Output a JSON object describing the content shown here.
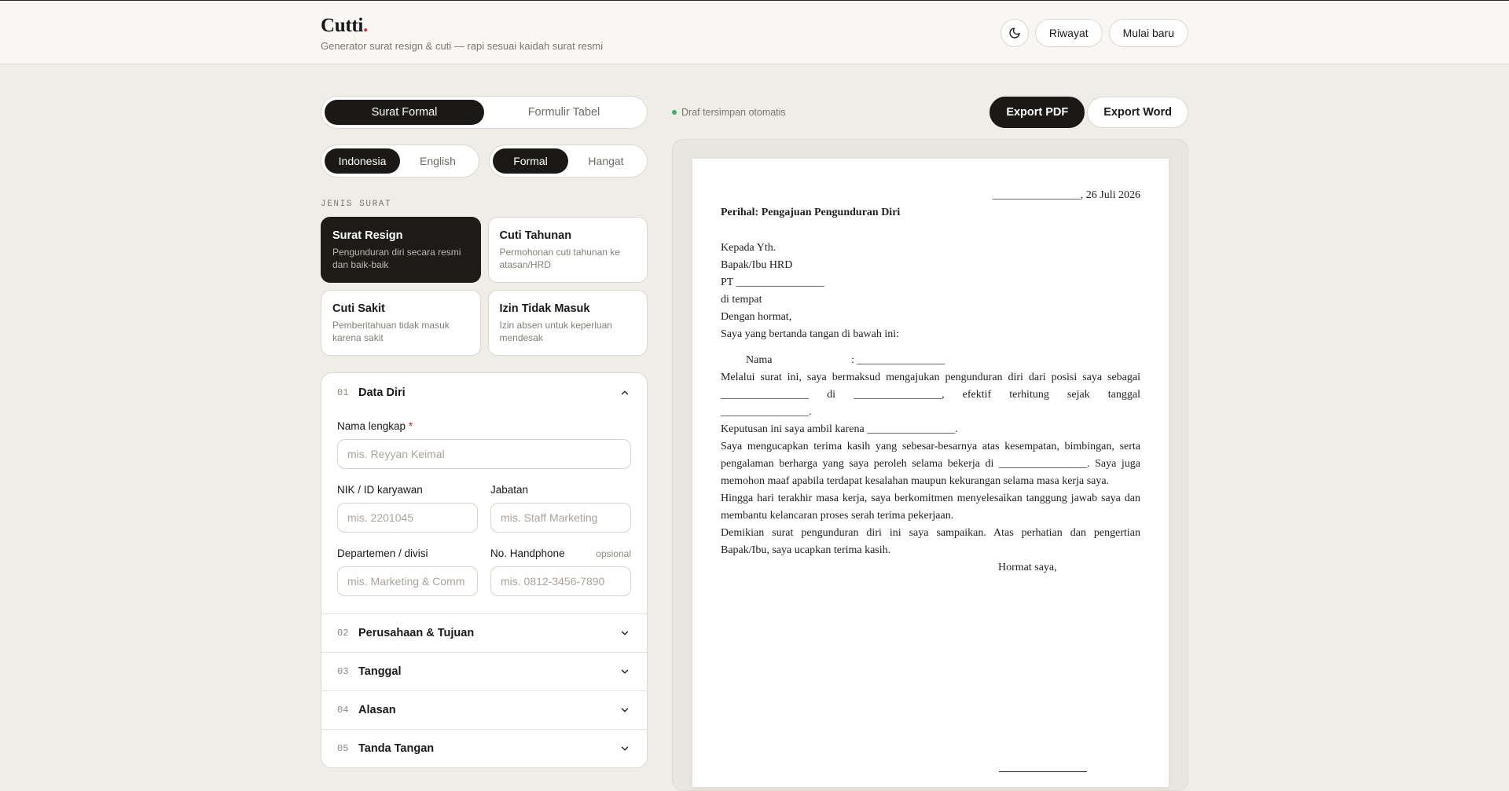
{
  "header": {
    "brand": "Cutti",
    "brand_dot": ".",
    "tagline": "Generator surat resign & cuti — rapi sesuai kaidah surat resmi",
    "theme_icon": "moon-icon",
    "history_label": "Riwayat",
    "new_label": "Mulai baru"
  },
  "mode_tabs": [
    {
      "label": "Surat Formal",
      "active": true
    },
    {
      "label": "Formulir Tabel",
      "active": false
    }
  ],
  "language_tabs": [
    {
      "label": "Indonesia",
      "active": true
    },
    {
      "label": "English",
      "active": false
    }
  ],
  "tone_tabs": [
    {
      "label": "Formal",
      "active": true
    },
    {
      "label": "Hangat",
      "active": false
    }
  ],
  "letter_types": {
    "section_label": "JENIS SURAT",
    "items": [
      {
        "title": "Surat Resign",
        "desc": "Pengunduran diri secara resmi dan baik-baik",
        "active": true
      },
      {
        "title": "Cuti Tahunan",
        "desc": "Permohonan cuti tahunan ke atasan/HRD",
        "active": false
      },
      {
        "title": "Cuti Sakit",
        "desc": "Pemberitahuan tidak masuk karena sakit",
        "active": false
      },
      {
        "title": "Izin Tidak Masuk",
        "desc": "Izin absen untuk keperluan mendesak",
        "active": false
      }
    ]
  },
  "form": {
    "sections": [
      {
        "num": "01",
        "title": "Data Diri",
        "open": true
      },
      {
        "num": "02",
        "title": "Perusahaan & Tujuan",
        "open": false
      },
      {
        "num": "03",
        "title": "Tanggal",
        "open": false
      },
      {
        "num": "04",
        "title": "Alasan",
        "open": false
      },
      {
        "num": "05",
        "title": "Tanda Tangan",
        "open": false
      }
    ],
    "fields": {
      "name": {
        "label": "Nama lengkap",
        "required_mark": "*",
        "placeholder": "mis. Reyyan Keimal"
      },
      "nik": {
        "label": "NIK / ID karyawan",
        "placeholder": "mis. 2201045"
      },
      "position": {
        "label": "Jabatan",
        "placeholder": "mis. Staff Marketing"
      },
      "department": {
        "label": "Departemen / divisi",
        "placeholder": "mis. Marketing & Comm"
      },
      "phone": {
        "label": "No. Handphone",
        "optional": "opsional",
        "placeholder": "mis. 0812-3456-7890"
      }
    }
  },
  "preview_bar": {
    "autosave": "Draf tersimpan otomatis",
    "export_pdf": "Export PDF",
    "export_word": "Export Word"
  },
  "letter": {
    "date": "________________, 26 Juli 2026",
    "subject": "Perihal: Pengajuan Pengunduran Diri",
    "address": [
      "Kepada Yth.",
      "Bapak/Ibu HRD",
      "PT ________________",
      "di tempat"
    ],
    "greeting": "Dengan hormat,",
    "intro": "Saya yang bertanda tangan di bawah ini:",
    "name_label": "Nama",
    "name_value": ":   ________________",
    "p1": "Melalui surat ini, saya bermaksud mengajukan pengunduran diri dari posisi saya sebagai ________________ di ________________, efektif terhitung sejak tanggal ________________.",
    "p2": "Keputusan ini saya ambil karena ________________.",
    "p3": "Saya mengucapkan terima kasih yang sebesar-besarnya atas kesempatan, bimbingan, serta pengalaman berharga yang saya peroleh selama bekerja di ________________. Saya juga memohon maaf apabila terdapat kesalahan maupun kekurangan selama masa kerja saya.",
    "p4": "Hingga hari terakhir masa kerja, saya berkomitmen menyelesaikan tanggung jawab saya dan membantu kelancaran proses serah terima pekerjaan.",
    "p5": "Demikian surat pengunduran diri ini saya sampaikan. Atas perhatian dan pengertian Bapak/Ibu, saya ucapkan terima kasih.",
    "closing": "Hormat saya,"
  }
}
